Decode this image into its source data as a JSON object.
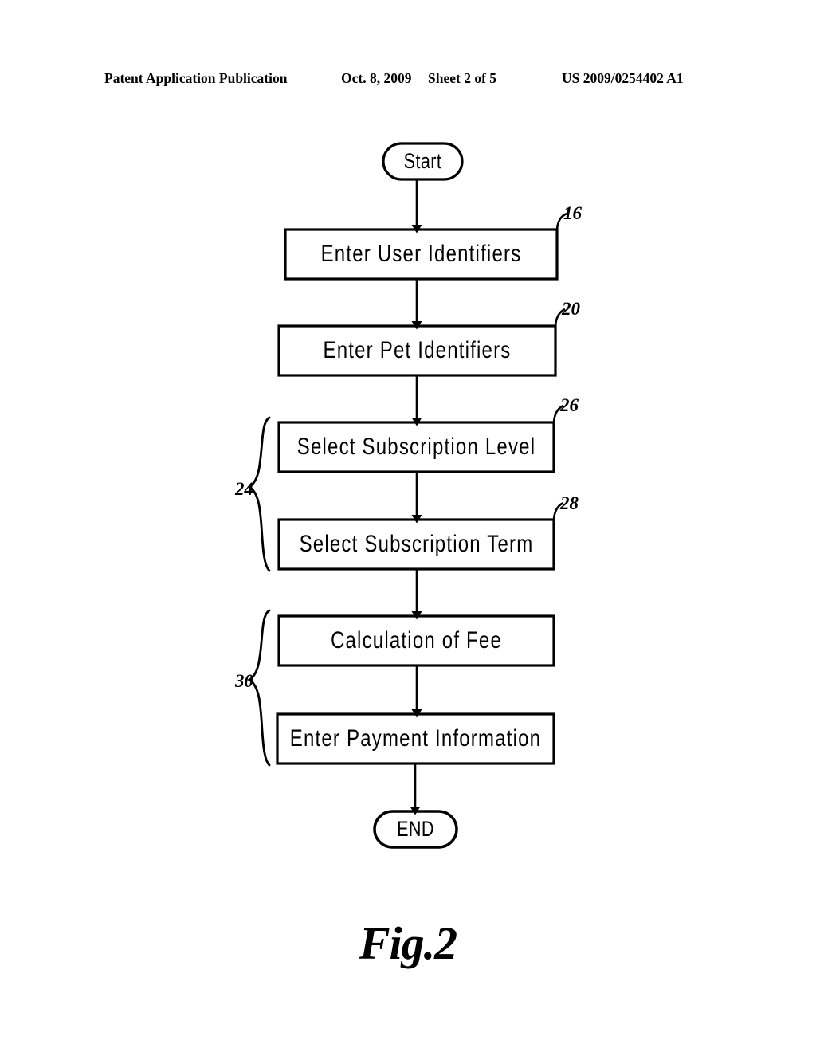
{
  "header": {
    "publication": "Patent Application Publication",
    "date": "Oct. 8, 2009",
    "sheet": "Sheet 2 of 5",
    "patent_number": "US 2009/0254402 A1"
  },
  "figure": {
    "caption": "Fig.2",
    "type": "flowchart",
    "orientation": "vertical-top-to-bottom"
  },
  "flowchart": {
    "start_node": {
      "label": "Start",
      "shape": "rounded-terminator"
    },
    "end_node": {
      "label": "END",
      "shape": "rounded-terminator"
    },
    "steps": [
      {
        "label": "Enter User Identifiers",
        "ref": "16"
      },
      {
        "label": "Enter Pet Identifiers",
        "ref": "20"
      },
      {
        "label": "Select Subscription Level",
        "ref": "26"
      },
      {
        "label": "Select Subscription Term",
        "ref": "28"
      },
      {
        "label": "Calculation of Fee",
        "ref": ""
      },
      {
        "label": "Enter Payment Information",
        "ref": ""
      }
    ],
    "group_brackets": [
      {
        "ref": "24",
        "spans": [
          "Select Subscription Level",
          "Select Subscription Term"
        ]
      },
      {
        "ref": "30",
        "spans": [
          "Calculation of Fee",
          "Enter Payment Information"
        ]
      }
    ],
    "colors": {
      "line": "#000000",
      "fill": "#ffffff",
      "background": "#ffffff"
    }
  }
}
